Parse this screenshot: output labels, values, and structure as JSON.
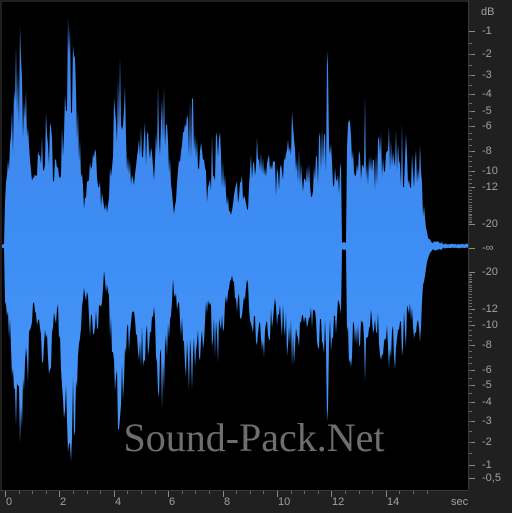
{
  "app": {
    "accent_color": "#3d8df5",
    "background_color": "#000000",
    "ruler_color": "#202020"
  },
  "db_ruler": {
    "unit_label": "dB",
    "top_half": [
      {
        "text": "-1",
        "db": -1
      },
      {
        "text": "-2",
        "db": -2
      },
      {
        "text": "-3",
        "db": -3
      },
      {
        "text": "-4",
        "db": -4
      },
      {
        "text": "-5",
        "db": -5
      },
      {
        "text": "-6",
        "db": -6
      },
      {
        "text": "-8",
        "db": -8
      },
      {
        "text": "-10",
        "db": -10
      },
      {
        "text": "-12",
        "db": -12
      },
      {
        "text": "-20",
        "db": -20
      }
    ],
    "center_label": "-∞",
    "bottom_half": [
      {
        "text": "-20",
        "db": -20
      },
      {
        "text": "-12",
        "db": -12
      },
      {
        "text": "-10",
        "db": -10
      },
      {
        "text": "-8",
        "db": -8
      },
      {
        "text": "-6",
        "db": -6
      },
      {
        "text": "-5",
        "db": -5
      },
      {
        "text": "-4",
        "db": -4
      },
      {
        "text": "-3",
        "db": -3
      },
      {
        "text": "-2",
        "db": -2
      },
      {
        "text": "-1",
        "db": -1
      },
      {
        "text": "-0,5",
        "db": -0.5
      }
    ]
  },
  "time_ruler": {
    "unit_label": "sec",
    "labels": [
      {
        "text": "0",
        "sec": 0
      },
      {
        "text": "2",
        "sec": 2
      },
      {
        "text": "4",
        "sec": 4
      },
      {
        "text": "6",
        "sec": 6
      },
      {
        "text": "8",
        "sec": 8
      },
      {
        "text": "10",
        "sec": 10
      },
      {
        "text": "12",
        "sec": 12
      },
      {
        "text": "14",
        "sec": 14
      }
    ]
  },
  "watermark": "Sound-Pack.Net"
}
